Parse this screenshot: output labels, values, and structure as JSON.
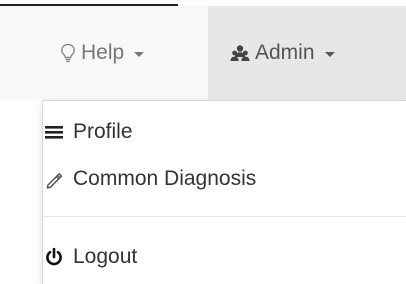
{
  "navbar": {
    "help": {
      "label": "Help",
      "icon": "lightbulb-icon"
    },
    "admin": {
      "label": "Admin",
      "icon": "users-icon"
    }
  },
  "dropdown": {
    "items": [
      {
        "label": "Profile",
        "icon": "bars-icon"
      },
      {
        "label": "Common Diagnosis",
        "icon": "pencil-icon"
      }
    ],
    "logout": {
      "label": "Logout",
      "icon": "power-icon"
    }
  },
  "colors": {
    "navbar_bg": "#f8f8f8",
    "active_nav_bg": "#e7e7e7",
    "nav_text": "#777777",
    "menu_text": "#333333"
  }
}
